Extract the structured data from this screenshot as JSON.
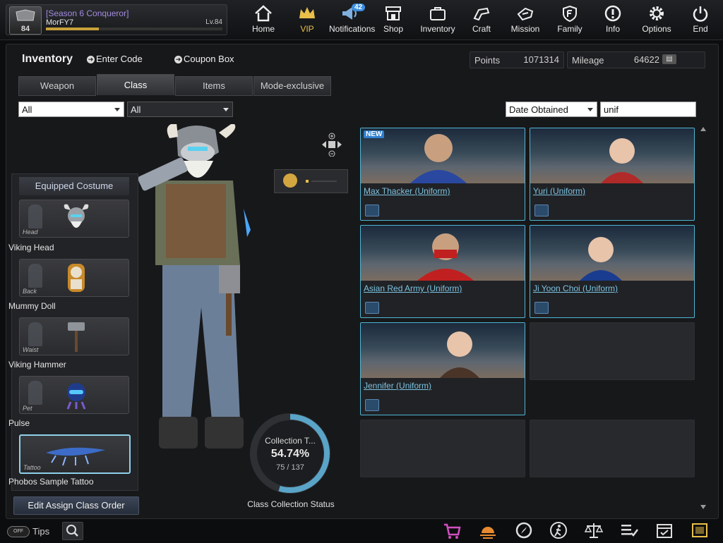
{
  "profile": {
    "season": "[Season 6 Conqueror]",
    "nickname": "MorFY7",
    "level": "Lv.84",
    "rank_number": "84",
    "xp_progress": 0.3
  },
  "nav": [
    {
      "label": "Home",
      "icon": "home-icon"
    },
    {
      "label": "VIP",
      "icon": "crown-icon"
    },
    {
      "label": "Notifications",
      "icon": "megaphone-icon",
      "badge": "42"
    },
    {
      "label": "Shop",
      "icon": "shop-icon"
    },
    {
      "label": "Inventory",
      "icon": "briefcase-icon"
    },
    {
      "label": "Craft",
      "icon": "craft-icon"
    },
    {
      "label": "Mission",
      "icon": "mission-icon"
    },
    {
      "label": "Family",
      "icon": "family-shield-icon"
    },
    {
      "label": "Info",
      "icon": "info-icon"
    },
    {
      "label": "Options",
      "icon": "gear-icon"
    },
    {
      "label": "End",
      "icon": "power-icon"
    }
  ],
  "inventory": {
    "title": "Inventory",
    "enter_code": "Enter Code",
    "coupon_box": "Coupon Box",
    "points_label": "Points",
    "points_value": "1071314",
    "mileage_label": "Mileage",
    "mileage_value": "64622"
  },
  "tabs": [
    "Weapon",
    "Class",
    "Items",
    "Mode-exclusive"
  ],
  "filters": {
    "filter1": "All",
    "filter2": "All",
    "sort": "Date Obtained",
    "search": "unif"
  },
  "equipped": {
    "title": "Equipped Costume",
    "slots": [
      {
        "type": "Head",
        "name": "Viking Head"
      },
      {
        "type": "Back",
        "name": "Mummy Doll"
      },
      {
        "type": "Waist",
        "name": "Viking Hammer"
      },
      {
        "type": "Pet",
        "name": "Pulse"
      },
      {
        "type": "Tattoo",
        "name": "Phobos Sample Tattoo"
      }
    ],
    "edit_order": "Edit Assign Class Order"
  },
  "collection": {
    "title": "Collection T...",
    "percent": "54.74%",
    "count": "75 / 137",
    "caption": "Class Collection Status",
    "fraction": 0.5474
  },
  "cards": [
    {
      "name": "Max Thacker (Uniform)",
      "badge": "NEW"
    },
    {
      "name": "Yuri (Uniform)"
    },
    {
      "name": "Asian Red Army (Uniform)"
    },
    {
      "name": "Ji Yoon Choi (Uniform)"
    },
    {
      "name": "Jennifer (Uniform)"
    }
  ],
  "bottom": {
    "tips_toggle": "OFF",
    "tips_label": "Tips"
  },
  "colors": {
    "accent": "#4fb6d6",
    "vip": "#e8c04a",
    "season": "#a48be0"
  }
}
